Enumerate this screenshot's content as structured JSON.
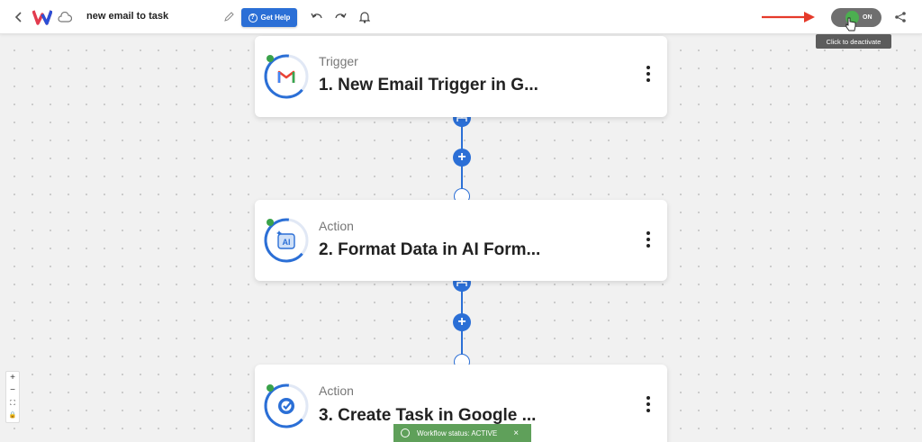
{
  "header": {
    "title": "new email to task",
    "help_label": "Get Help",
    "toggle_label": "ON",
    "tooltip": "Click to deactivate"
  },
  "steps": [
    {
      "kind": "Trigger",
      "name": "1. New Email Trigger in G..."
    },
    {
      "kind": "Action",
      "name": "2. Format Data in AI Form..."
    },
    {
      "kind": "Action",
      "name": "3. Create Task in Google ..."
    }
  ],
  "zoom": {
    "in": "+",
    "out": "−",
    "fit": "⛶",
    "lock": "🔒"
  },
  "toast": {
    "text": "Workflow status: ACTIVE",
    "close": "×"
  },
  "colors": {
    "accent": "#2b6fd6",
    "active": "#4caf50",
    "toast": "#5fa05a",
    "arrow": "#e53a2a"
  },
  "icons": [
    "back-icon",
    "logo-icon",
    "cloud-icon",
    "pencil-icon",
    "help-icon",
    "undo-icon",
    "redo-icon",
    "bell-icon",
    "share-icon",
    "gmail-icon",
    "ai-formatter-icon",
    "google-tasks-icon",
    "kebab-icon"
  ]
}
